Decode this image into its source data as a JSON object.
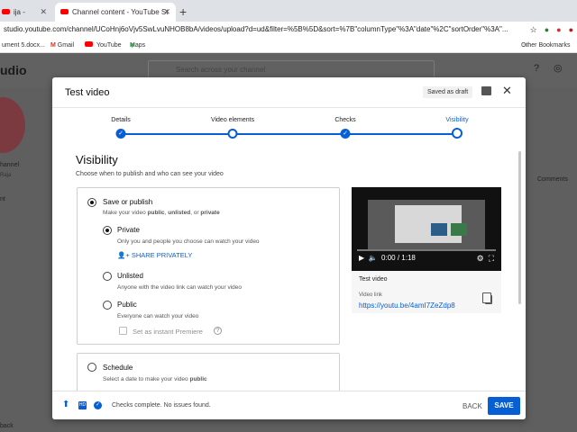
{
  "browser": {
    "tabs": [
      {
        "label": "ija - YouTube"
      },
      {
        "label": "Channel content - YouTube St"
      }
    ],
    "url": "studio.youtube.com/channel/UCoHnj6oVjv5SwLvuNHOB8bA/videos/upload?d=ud&filter=%5B%5D&sort=%7B\"columnType\"%3A\"date\"%2C\"sortOrder\"%3A\"...",
    "bookmarks": [
      "ument 5.docx...",
      "Gmail",
      "YouTube",
      "Maps",
      "Other Bookmarks"
    ]
  },
  "studio_bg": {
    "logo_fragment": "udio",
    "search_placeholder": "Search across your channel",
    "channel_label": "hannel",
    "channel_sub": "Raja",
    "side_frag": "nt",
    "comments_col": "Comments",
    "back_link": "back"
  },
  "modal": {
    "title": "Test video",
    "saved_badge": "Saved as draft",
    "steps": [
      {
        "label": "Details",
        "state": "done"
      },
      {
        "label": "Video elements",
        "state": "current"
      },
      {
        "label": "Checks",
        "state": "done"
      },
      {
        "label": "Visibility",
        "state": "active"
      }
    ],
    "visibility": {
      "heading": "Visibility",
      "subheading": "Choose when to publish and who can see your video",
      "save_publish": {
        "label": "Save or publish",
        "desc_pre": "Make your video ",
        "desc_b1": "public",
        "desc_mid": ", ",
        "desc_b2": "unlisted",
        "desc_mid2": ", or ",
        "desc_b3": "private"
      },
      "options": [
        {
          "label": "Private",
          "desc": "Only you and people you choose can watch your video",
          "selected": true
        },
        {
          "label": "Unlisted",
          "desc": "Anyone with the video link can watch your video",
          "selected": false
        },
        {
          "label": "Public",
          "desc": "Everyone can watch your video",
          "selected": false
        }
      ],
      "share_privately": "SHARE PRIVATELY",
      "instant_premiere": "Set as instant Premiere",
      "schedule": {
        "label": "Schedule",
        "desc_pre": "Select a date to make your video ",
        "desc_b": "public"
      }
    },
    "preview": {
      "time": "0:00 / 1:18",
      "title": "Test video",
      "video_link_label": "Video link",
      "video_link": "https://youtu.be/4amI7ZeZdp8"
    },
    "footer": {
      "status": "Checks complete. No issues found.",
      "back": "BACK",
      "save": "SAVE"
    }
  },
  "colors": {
    "accent": "#065fd4"
  }
}
